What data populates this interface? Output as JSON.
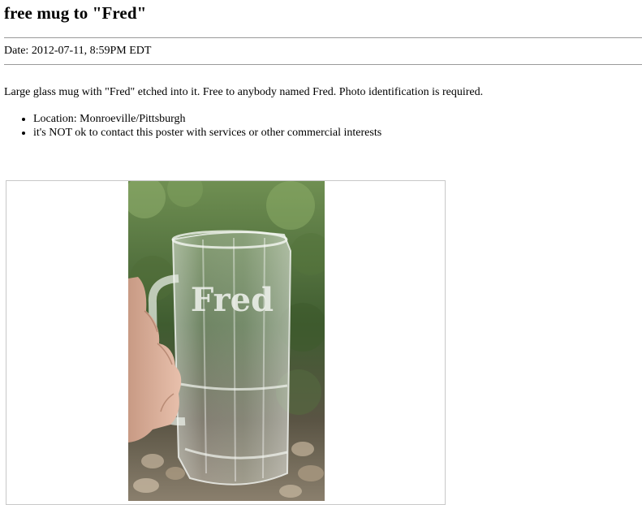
{
  "post": {
    "title": "free mug to \"Fred\"",
    "date": "Date: 2012-07-11, 8:59PM EDT",
    "description": "Large glass mug with \"Fred\" etched into it. Free to anybody named Fred. Photo identification is required.",
    "facts": [
      "Location: Monroeville/Pittsburgh",
      "it's NOT ok to contact this poster with services or other commercial interests"
    ]
  },
  "photo": {
    "etched_text": "Fred"
  },
  "colors": {
    "foliage": "#4d6b3a",
    "rule": "#9a9a9a",
    "frame_border": "#c8c8c8"
  }
}
